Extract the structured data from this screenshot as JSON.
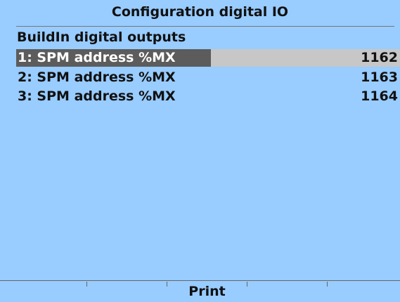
{
  "header": {
    "title": "Configuration digital IO"
  },
  "section": {
    "label": "BuildIn digital outputs"
  },
  "rows": [
    {
      "label": "1: SPM address %MX",
      "value": "1162",
      "selected": true
    },
    {
      "label": "2: SPM address %MX",
      "value": "1163",
      "selected": false
    },
    {
      "label": "3: SPM address %MX",
      "value": "1164",
      "selected": false
    }
  ],
  "softkeys": [
    "",
    "",
    "Print",
    "",
    ""
  ],
  "colors": {
    "background": "#99ccff",
    "selection_label": "#5c5c5c",
    "selection_value": "#c7c7c7"
  }
}
